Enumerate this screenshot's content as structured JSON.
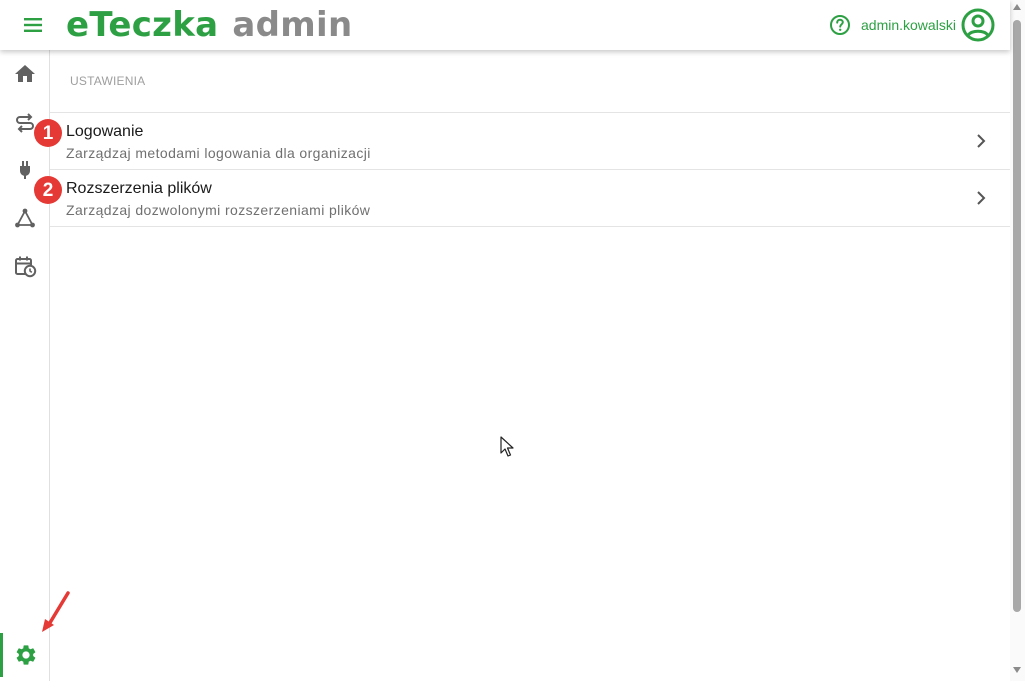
{
  "header": {
    "brand": "eTeczka",
    "brand_sub": "admin",
    "username": "admin.kowalski"
  },
  "icons": {
    "menu": "hamburger-menu-icon",
    "help": "help-circle-icon",
    "account": "account-circle-icon"
  },
  "sidebar": {
    "items": [
      {
        "name": "home",
        "icon": "home-icon"
      },
      {
        "name": "transfers",
        "icon": "swap-arrows-icon"
      },
      {
        "name": "integrations",
        "icon": "plug-icon"
      },
      {
        "name": "network",
        "icon": "network-icon"
      },
      {
        "name": "schedule",
        "icon": "calendar-clock-icon"
      },
      {
        "name": "settings",
        "icon": "gear-icon",
        "active": true
      }
    ]
  },
  "main": {
    "section_title": "USTAWIENIA",
    "items": [
      {
        "badge": "1",
        "title": "Logowanie",
        "description": "Zarządzaj metodami logowania dla organizacji"
      },
      {
        "badge": "2",
        "title": "Rozszerzenia plików",
        "description": "Zarządzaj dozwolonymi rozszerzeniami plików"
      }
    ]
  },
  "colors": {
    "brand_green": "#2da044",
    "brand_gray": "#8a8a8a",
    "badge_red": "#e53935",
    "icon_gray": "#616161"
  }
}
